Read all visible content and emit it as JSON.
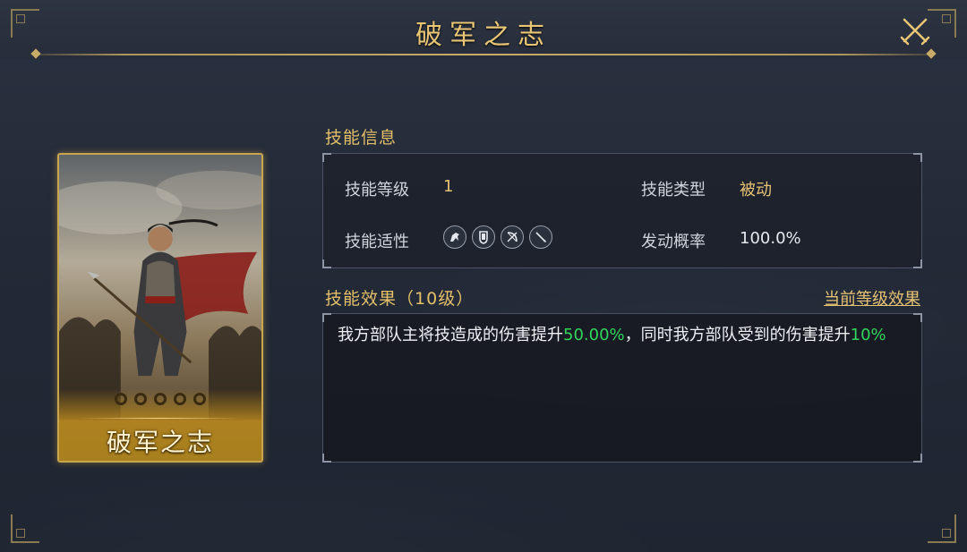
{
  "window": {
    "title": "破军之志"
  },
  "card": {
    "name": "破军之志",
    "stars_total": 5
  },
  "skill_info": {
    "section_title": "技能信息",
    "level_label": "技能等级",
    "level_value": "1",
    "type_label": "技能类型",
    "type_value": "被动",
    "adapt_label": "技能适性",
    "adapt_icons": [
      "cavalry-icon",
      "shield-icon",
      "archer-icon",
      "spear-icon"
    ],
    "rate_label": "发动概率",
    "rate_value": "100.0%"
  },
  "skill_effect": {
    "section_title": "技能效果",
    "level_note": "（10级）",
    "current_level_link": "当前等级效果",
    "text_part1": "我方部队主将技造成的伤害提升",
    "value1": "50.00%",
    "text_part2": "，同时我方部队受到的伤害提升",
    "value2": "10%"
  },
  "colors": {
    "accent_gold": "#e6c274",
    "highlight_green": "#33d45c",
    "card_border": "#c9a64e"
  }
}
